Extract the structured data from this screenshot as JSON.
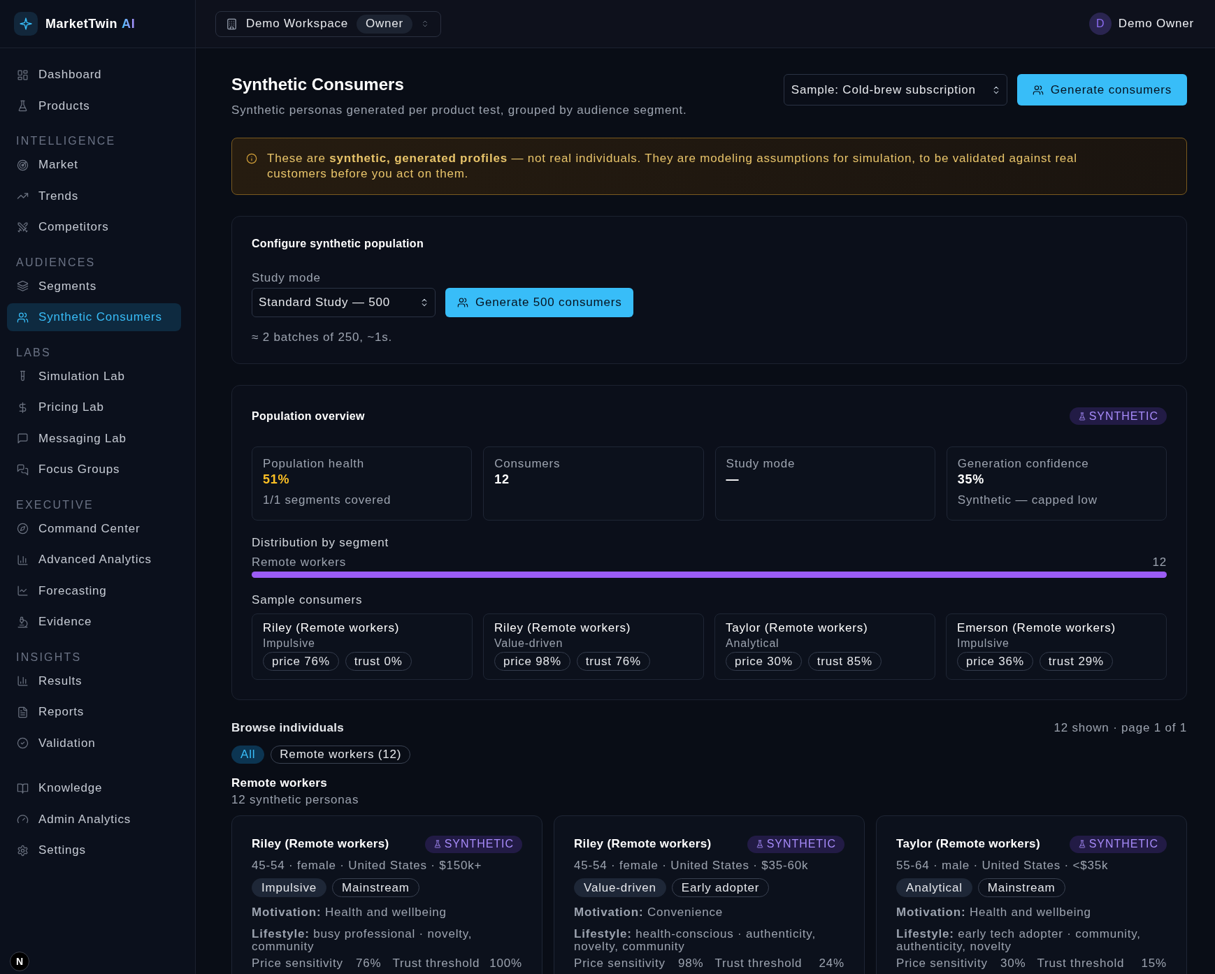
{
  "sidebar": {
    "brand": {
      "name": "MarketTwin",
      "accent": "AI"
    },
    "sections": [
      {
        "items": [
          {
            "label": "Dashboard",
            "selected": false
          },
          {
            "label": "Products",
            "selected": false
          }
        ]
      },
      {
        "title": "INTELLIGENCE",
        "items": [
          {
            "label": "Market",
            "selected": false
          },
          {
            "label": "Trends",
            "selected": false
          },
          {
            "label": "Competitors",
            "selected": false
          }
        ]
      },
      {
        "title": "AUDIENCES",
        "items": [
          {
            "label": "Segments",
            "selected": false
          },
          {
            "label": "Synthetic Consumers",
            "selected": true
          }
        ]
      },
      {
        "title": "LABS",
        "items": [
          {
            "label": "Simulation Lab",
            "selected": false
          },
          {
            "label": "Pricing Lab",
            "selected": false
          },
          {
            "label": "Messaging Lab",
            "selected": false
          },
          {
            "label": "Focus Groups",
            "selected": false
          }
        ]
      },
      {
        "title": "EXECUTIVE",
        "items": [
          {
            "label": "Command Center",
            "selected": false
          },
          {
            "label": "Advanced Analytics",
            "selected": false
          },
          {
            "label": "Forecasting",
            "selected": false
          },
          {
            "label": "Evidence",
            "selected": false
          }
        ]
      },
      {
        "title": "INSIGHTS",
        "items": [
          {
            "label": "Results",
            "selected": false
          },
          {
            "label": "Reports",
            "selected": false
          },
          {
            "label": "Validation",
            "selected": false
          }
        ]
      },
      {
        "items": [
          {
            "label": "Knowledge",
            "selected": false
          },
          {
            "label": "Admin Analytics",
            "selected": false
          },
          {
            "label": "Settings",
            "selected": false
          }
        ]
      }
    ],
    "dev_badge": "N"
  },
  "topbar": {
    "workspace": {
      "name": "Demo Workspace",
      "role": "Owner"
    },
    "user": {
      "initial": "D",
      "name": "Demo Owner"
    }
  },
  "page": {
    "title": "Synthetic Consumers",
    "subtitle": "Synthetic personas generated per product test, grouped by audience segment.",
    "sample_select": "Sample: Cold-brew subscription",
    "generate_button": "Generate consumers"
  },
  "notice": "These are **synthetic, generated profiles** — not real individuals. They are modeling assumptions for simulation, to be validated against real customers before you act on them.",
  "configure": {
    "title": "Configure synthetic population",
    "study_mode": {
      "label": "Study mode",
      "value": "Standard Study — 500"
    },
    "generate_button": "Generate 500 consumers",
    "hint": "≈ 2 batches of 250, ~1s."
  },
  "overview": {
    "title": "Population overview",
    "badge": "SYNTHETIC",
    "stats": [
      {
        "label": "Population health",
        "value": "51%",
        "note": "1/1 segments covered",
        "warning": true
      },
      {
        "label": "Consumers",
        "value": "12",
        "warning": false
      },
      {
        "label": "Study mode",
        "value": "—",
        "warning": false
      },
      {
        "label": "Generation confidence",
        "value": "35%",
        "note": "Synthetic — capped low",
        "warning": false
      }
    ],
    "distribution": {
      "title": "Distribution by segment",
      "segments": [
        {
          "name": "Remote workers",
          "count": "12",
          "level": 1
        }
      ]
    },
    "samples": {
      "title": "Sample consumers",
      "items": [
        {
          "name": "Riley (Remote workers)",
          "style": "Impulsive",
          "price": "price 76%",
          "trust": "trust 0%"
        },
        {
          "name": "Riley (Remote workers)",
          "style": "Value-driven",
          "price": "price 98%",
          "trust": "trust 76%"
        },
        {
          "name": "Taylor (Remote workers)",
          "style": "Analytical",
          "price": "price 30%",
          "trust": "trust 85%"
        },
        {
          "name": "Emerson (Remote workers)",
          "style": "Impulsive",
          "price": "price 36%",
          "trust": "trust 29%"
        }
      ]
    }
  },
  "browse": {
    "title": "Browse individuals",
    "summary": "12 shown · page 1 of 1",
    "filters": [
      {
        "label": "All",
        "selected": true
      },
      {
        "label": "Remote workers (12)",
        "selected": false
      }
    ],
    "groups": [
      {
        "title": "Remote workers",
        "subtitle": "12 synthetic personas",
        "personas": [
          {
            "name": "Riley (Remote workers)",
            "badge": "SYNTHETIC",
            "demographics": "45-54 · female · United States · $150k+",
            "tags": [
              {
                "label": "Impulsive",
                "kind": "style"
              },
              {
                "label": "Mainstream",
                "kind": "adoption"
              }
            ],
            "motivation": "**Motivation:** Health and wellbeing",
            "lifestyle": "**Lifestyle:** busy professional · novelty, community",
            "metrics": [
              {
                "label": "Price sensitivity",
                "value": "76%"
              },
              {
                "label": "Trust threshold",
                "value": "100%"
              }
            ]
          },
          {
            "name": "Riley (Remote workers)",
            "badge": "SYNTHETIC",
            "demographics": "45-54 · female · United States · $35-60k",
            "tags": [
              {
                "label": "Value-driven",
                "kind": "style"
              },
              {
                "label": "Early adopter",
                "kind": "adoption"
              }
            ],
            "motivation": "**Motivation:** Convenience",
            "lifestyle": "**Lifestyle:** health-conscious · authenticity, novelty, community",
            "metrics": [
              {
                "label": "Price sensitivity",
                "value": "98%"
              },
              {
                "label": "Trust threshold",
                "value": "24%"
              }
            ]
          },
          {
            "name": "Taylor (Remote workers)",
            "badge": "SYNTHETIC",
            "demographics": "55-64 · male · United States · <$35k",
            "tags": [
              {
                "label": "Analytical",
                "kind": "style"
              },
              {
                "label": "Mainstream",
                "kind": "adoption"
              }
            ],
            "motivation": "**Motivation:** Health and wellbeing",
            "lifestyle": "**Lifestyle:** early tech adopter · community, authenticity, novelty",
            "metrics": [
              {
                "label": "Price sensitivity",
                "value": "30%"
              },
              {
                "label": "Trust threshold",
                "value": "15%"
              }
            ]
          }
        ]
      }
    ]
  }
}
